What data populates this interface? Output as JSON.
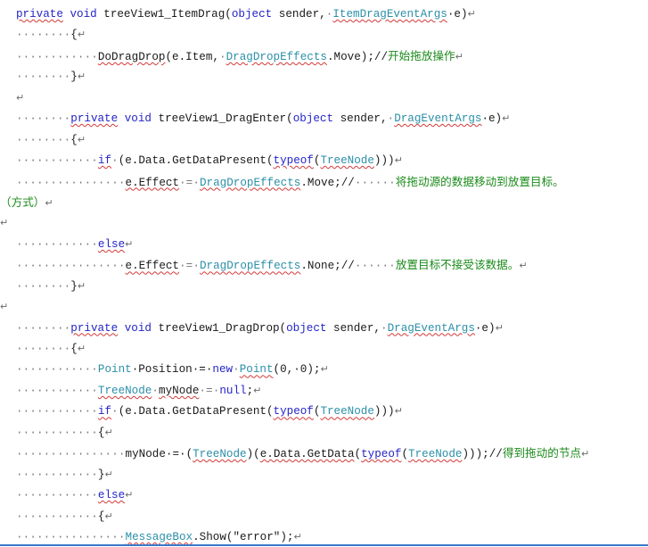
{
  "code_lines": [
    {
      "name": "itemdrag-signature",
      "tokens": [
        {
          "t": "private",
          "c": "kw sq"
        },
        {
          "t": " ",
          "c": "txt"
        },
        {
          "t": "void",
          "c": "kw"
        },
        {
          "t": " treeView1_ItemDrag(",
          "c": "txt"
        },
        {
          "t": "object",
          "c": "kw"
        },
        {
          "t": " sender,",
          "c": "txt"
        },
        {
          "t": "·",
          "c": "dots"
        },
        {
          "t": "ItemDragEventArgs",
          "c": "typ sq"
        },
        {
          "t": "·e)",
          "c": "txt"
        },
        {
          "t": "↵",
          "c": "mark"
        }
      ]
    },
    {
      "name": "open-brace-1",
      "tokens": [
        {
          "t": "········",
          "c": "dots"
        },
        {
          "t": "{",
          "c": "txt"
        },
        {
          "t": "↵",
          "c": "mark"
        }
      ]
    },
    {
      "name": "dodragdrop-call",
      "tokens": [
        {
          "t": "············",
          "c": "dots"
        },
        {
          "t": "DoDragDrop",
          "c": "txt sq"
        },
        {
          "t": "(e.Item,",
          "c": "txt"
        },
        {
          "t": "·",
          "c": "dots"
        },
        {
          "t": "DragDropEffects",
          "c": "typ sq"
        },
        {
          "t": ".Move);//",
          "c": "txt"
        },
        {
          "t": "开始拖放操作",
          "c": "cmt"
        },
        {
          "t": "↵",
          "c": "mark"
        }
      ]
    },
    {
      "name": "close-brace-1",
      "tokens": [
        {
          "t": "········",
          "c": "dots"
        },
        {
          "t": "}",
          "c": "txt"
        },
        {
          "t": "↵",
          "c": "mark"
        }
      ]
    },
    {
      "name": "blank-1",
      "tokens": [
        {
          "t": "↵",
          "c": "mark"
        }
      ]
    },
    {
      "name": "dragenter-signature",
      "tokens": [
        {
          "t": "········",
          "c": "dots"
        },
        {
          "t": "private",
          "c": "kw sq"
        },
        {
          "t": " ",
          "c": "txt"
        },
        {
          "t": "void",
          "c": "kw"
        },
        {
          "t": " treeView1_DragEnter(",
          "c": "txt"
        },
        {
          "t": "object",
          "c": "kw"
        },
        {
          "t": " sender,",
          "c": "txt"
        },
        {
          "t": "·",
          "c": "dots"
        },
        {
          "t": "DragEventArgs",
          "c": "typ sq"
        },
        {
          "t": "·e)",
          "c": "txt"
        },
        {
          "t": "↵",
          "c": "mark"
        }
      ]
    },
    {
      "name": "open-brace-2",
      "tokens": [
        {
          "t": "········",
          "c": "dots"
        },
        {
          "t": "{",
          "c": "txt"
        },
        {
          "t": "↵",
          "c": "mark"
        }
      ]
    },
    {
      "name": "if-getdatapresent-1",
      "tokens": [
        {
          "t": "············",
          "c": "dots"
        },
        {
          "t": "if",
          "c": "kw sq"
        },
        {
          "t": "·",
          "c": "dots"
        },
        {
          "t": "(e.Data.GetDataPresent(",
          "c": "txt"
        },
        {
          "t": "typeof",
          "c": "kw sq"
        },
        {
          "t": "(",
          "c": "txt"
        },
        {
          "t": "TreeNode",
          "c": "typ sq"
        },
        {
          "t": ")))",
          "c": "txt"
        },
        {
          "t": "↵",
          "c": "mark"
        }
      ]
    },
    {
      "name": "effect-move",
      "tokens": [
        {
          "t": "················",
          "c": "dots"
        },
        {
          "t": "e.Effect",
          "c": "txt sq"
        },
        {
          "t": "·=·",
          "c": "dots"
        },
        {
          "t": "DragDropEffects",
          "c": "typ sq"
        },
        {
          "t": ".Move;//",
          "c": "txt"
        },
        {
          "t": "······",
          "c": "dots"
        },
        {
          "t": "将拖动源的数据移动到放置目标。",
          "c": "cmt"
        }
      ]
    },
    {
      "name": "effect-move-wrap",
      "wrap": true,
      "tokens": [
        {
          "t": "（方式）",
          "c": "cmt"
        },
        {
          "t": "↵",
          "c": "mark"
        }
      ]
    },
    {
      "name": "blank-2",
      "wrap": true,
      "tokens": [
        {
          "t": "↵",
          "c": "mark"
        }
      ]
    },
    {
      "name": "else-1",
      "tokens": [
        {
          "t": "············",
          "c": "dots"
        },
        {
          "t": "else",
          "c": "kw sq"
        },
        {
          "t": "↵",
          "c": "mark"
        }
      ]
    },
    {
      "name": "effect-none",
      "tokens": [
        {
          "t": "················",
          "c": "dots"
        },
        {
          "t": "e.Effect",
          "c": "txt sq"
        },
        {
          "t": "·=·",
          "c": "dots"
        },
        {
          "t": "DragDropEffects",
          "c": "typ sq"
        },
        {
          "t": ".None;//",
          "c": "txt"
        },
        {
          "t": "······",
          "c": "dots"
        },
        {
          "t": "放置目标不接受该数据。",
          "c": "cmt"
        },
        {
          "t": "↵",
          "c": "mark"
        }
      ]
    },
    {
      "name": "close-brace-2",
      "tokens": [
        {
          "t": "········",
          "c": "dots"
        },
        {
          "t": "}",
          "c": "txt"
        },
        {
          "t": "↵",
          "c": "mark"
        }
      ]
    },
    {
      "name": "blank-3",
      "wrap": true,
      "tokens": [
        {
          "t": "↵",
          "c": "mark"
        }
      ]
    },
    {
      "name": "dragdrop-signature",
      "tokens": [
        {
          "t": "········",
          "c": "dots"
        },
        {
          "t": "private",
          "c": "kw sq"
        },
        {
          "t": " ",
          "c": "txt"
        },
        {
          "t": "void",
          "c": "kw"
        },
        {
          "t": " treeView1_DragDrop(",
          "c": "txt"
        },
        {
          "t": "object",
          "c": "kw"
        },
        {
          "t": " sender,",
          "c": "txt"
        },
        {
          "t": "·",
          "c": "dots"
        },
        {
          "t": "DragEventArgs",
          "c": "typ sq"
        },
        {
          "t": "·e)",
          "c": "txt"
        },
        {
          "t": "↵",
          "c": "mark"
        }
      ]
    },
    {
      "name": "open-brace-3",
      "tokens": [
        {
          "t": "········",
          "c": "dots"
        },
        {
          "t": "{",
          "c": "txt"
        },
        {
          "t": "↵",
          "c": "mark"
        }
      ]
    },
    {
      "name": "point-position",
      "tokens": [
        {
          "t": "············",
          "c": "dots"
        },
        {
          "t": "Point",
          "c": "typ"
        },
        {
          "t": "·Position·=·",
          "c": "txt"
        },
        {
          "t": "new",
          "c": "kw"
        },
        {
          "t": "·",
          "c": "dots"
        },
        {
          "t": "Point",
          "c": "typ sq"
        },
        {
          "t": "(0,·0);",
          "c": "txt"
        },
        {
          "t": "↵",
          "c": "mark"
        }
      ]
    },
    {
      "name": "treenode-mynode",
      "tokens": [
        {
          "t": "············",
          "c": "dots"
        },
        {
          "t": "TreeNode",
          "c": "typ sq"
        },
        {
          "t": "·",
          "c": "dots"
        },
        {
          "t": "myNode",
          "c": "txt sq"
        },
        {
          "t": "·=·",
          "c": "dots"
        },
        {
          "t": "null",
          "c": "kw"
        },
        {
          "t": ";",
          "c": "txt"
        },
        {
          "t": "↵",
          "c": "mark"
        }
      ]
    },
    {
      "name": "if-getdatapresent-2",
      "tokens": [
        {
          "t": "············",
          "c": "dots"
        },
        {
          "t": "if",
          "c": "kw sq"
        },
        {
          "t": "·",
          "c": "dots"
        },
        {
          "t": "(e.Data.GetDataPresent(",
          "c": "txt"
        },
        {
          "t": "typeof",
          "c": "kw sq"
        },
        {
          "t": "(",
          "c": "txt"
        },
        {
          "t": "TreeNode",
          "c": "typ sq"
        },
        {
          "t": ")))",
          "c": "txt"
        },
        {
          "t": "↵",
          "c": "mark"
        }
      ]
    },
    {
      "name": "open-brace-4",
      "tokens": [
        {
          "t": "············",
          "c": "dots"
        },
        {
          "t": "{",
          "c": "txt"
        },
        {
          "t": "↵",
          "c": "mark"
        }
      ]
    },
    {
      "name": "mynode-assign",
      "tokens": [
        {
          "t": "················",
          "c": "dots"
        },
        {
          "t": "myNode",
          "c": "txt"
        },
        {
          "t": "·=·(",
          "c": "txt"
        },
        {
          "t": "TreeNode",
          "c": "typ sq"
        },
        {
          "t": ")(",
          "c": "txt"
        },
        {
          "t": "e.Data.GetData",
          "c": "txt sq"
        },
        {
          "t": "(",
          "c": "txt"
        },
        {
          "t": "typeof",
          "c": "kw sq"
        },
        {
          "t": "(",
          "c": "txt"
        },
        {
          "t": "TreeNode",
          "c": "typ sq"
        },
        {
          "t": ")));//",
          "c": "txt"
        },
        {
          "t": "得到拖动的节点",
          "c": "cmt"
        },
        {
          "t": "↵",
          "c": "mark"
        }
      ]
    },
    {
      "name": "close-brace-4",
      "tokens": [
        {
          "t": "············",
          "c": "dots"
        },
        {
          "t": "}",
          "c": "txt"
        },
        {
          "t": "↵",
          "c": "mark"
        }
      ]
    },
    {
      "name": "else-2",
      "tokens": [
        {
          "t": "············",
          "c": "dots"
        },
        {
          "t": "else",
          "c": "kw sq"
        },
        {
          "t": "↵",
          "c": "mark"
        }
      ]
    },
    {
      "name": "open-brace-5",
      "tokens": [
        {
          "t": "············",
          "c": "dots"
        },
        {
          "t": "{",
          "c": "txt"
        },
        {
          "t": "↵",
          "c": "mark"
        }
      ]
    },
    {
      "name": "messagebox-show",
      "tokens": [
        {
          "t": "················",
          "c": "dots"
        },
        {
          "t": "MessageBox",
          "c": "typ sq"
        },
        {
          "t": ".Show(\"error\");",
          "c": "txt"
        },
        {
          "t": "↵",
          "c": "mark"
        }
      ]
    }
  ]
}
